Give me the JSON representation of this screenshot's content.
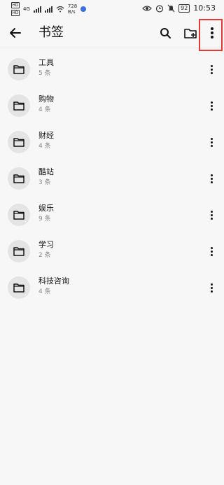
{
  "status_bar": {
    "sim1": "HD",
    "sim2": "HD",
    "network": "4G",
    "speed_value": "728",
    "speed_unit": "B/s",
    "battery": "92",
    "time": "10:53"
  },
  "app_bar": {
    "title": "书签"
  },
  "bookmark_folders": [
    {
      "name": "工具",
      "count": "5 条"
    },
    {
      "name": "购物",
      "count": "4 条"
    },
    {
      "name": "财经",
      "count": "4 条"
    },
    {
      "name": "酷站",
      "count": "3 条"
    },
    {
      "name": "娱乐",
      "count": "9 条"
    },
    {
      "name": "学习",
      "count": "2 条"
    },
    {
      "name": "科技咨询",
      "count": "4 条"
    }
  ],
  "icons": {
    "back": "arrow-left-icon",
    "search": "search-icon",
    "new_folder": "folder-plus-icon",
    "more": "more-vert-icon",
    "folder": "folder-icon"
  },
  "colors": {
    "highlight": "#e53935"
  }
}
